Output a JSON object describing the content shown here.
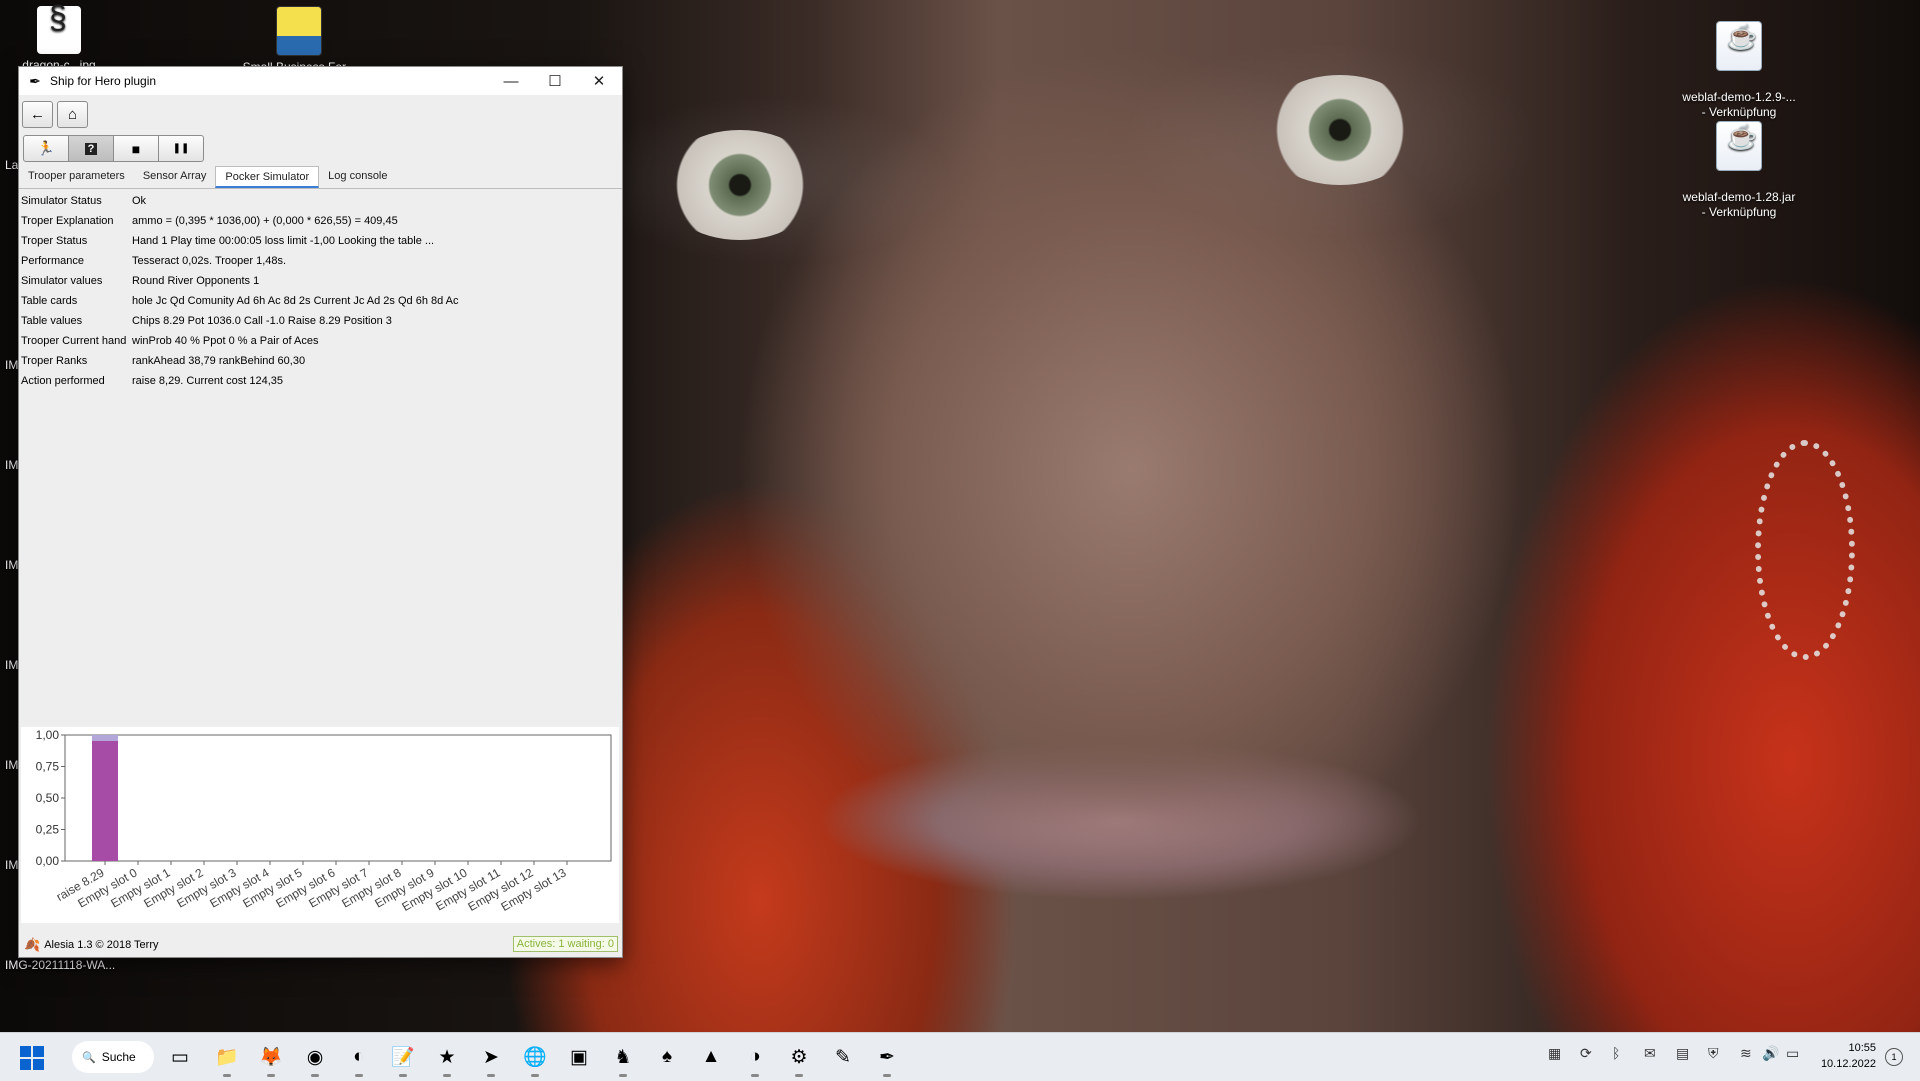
{
  "desktop": {
    "icons": [
      {
        "label": "dragon-c...jpg"
      },
      {
        "label": "Small Business For..."
      },
      {
        "label": "weblaf-demo-1.2.9-...\n- Verknüpfung"
      },
      {
        "label": "weblaf-demo-1.28.jar\n- Verknüpfung"
      }
    ],
    "side_labels": [
      "La",
      "IM",
      "IM",
      "IM",
      "IM",
      "IM",
      "IM"
    ],
    "bottom_label": "IMG-20211118-WA..."
  },
  "window": {
    "title": "Ship for Hero plugin",
    "buttons": {
      "minimize": "—",
      "maximize": "☐",
      "close": "✕"
    },
    "nav": {
      "back_icon": "←",
      "home_icon": "⌂"
    },
    "toolbar": {
      "run_icon": "🏃",
      "help_icon": "?",
      "stop_icon": "■",
      "pause_icon": "❚❚"
    },
    "tabs": [
      "Trooper parameters",
      "Sensor Array",
      "Pocker Simulator",
      "Log console"
    ],
    "active_tab": "Pocker Simulator",
    "properties": [
      {
        "key": "Simulator Status",
        "value": "Ok"
      },
      {
        "key": "Troper Explanation",
        "value": "ammo = (0,395 * 1036,00) + (0,000 * 626,55) = 409,45"
      },
      {
        "key": "Troper Status",
        "value": "Hand 1 Play time 00:00:05 loss limit -1,00 Looking the table ..."
      },
      {
        "key": "Performance",
        "value": "Tesseract 0,02s. Trooper 1,48s."
      },
      {
        "key": "Simulator values",
        "value": "Round River Opponents 1"
      },
      {
        "key": "Table cards",
        "value": "hole Jc Qd Comunity Ad 6h Ac 8d 2s Current Jc Ad 2s Qd 6h 8d Ac"
      },
      {
        "key": "Table values",
        "value": "Chips 8.29 Pot 1036.0 Call -1.0 Raise 8.29 Position 3"
      },
      {
        "key": "Trooper Current hand",
        "value": "winProb 40 % Ppot 0 % a Pair of Aces"
      },
      {
        "key": "Troper Ranks",
        "value": "rankAhead 38,79 rankBehind 60,30"
      },
      {
        "key": "Action performed",
        "value": "raise 8,29. Current cost 124,35"
      }
    ],
    "status": {
      "text": "Alesia 1.3 © 2018 Terry",
      "badge": "Actives: 1 waiting: 0",
      "leaf_icon": "🍂"
    }
  },
  "chart_data": {
    "type": "bar",
    "categories": [
      "raise 8.29",
      "Empty slot 0",
      "Empty slot 1",
      "Empty slot 2",
      "Empty slot 3",
      "Empty slot 4",
      "Empty slot 5",
      "Empty slot 6",
      "Empty slot 7",
      "Empty slot 8",
      "Empty slot 9",
      "Empty slot 10",
      "Empty slot 11",
      "Empty slot 12",
      "Empty slot 13"
    ],
    "values": [
      1.0,
      0,
      0,
      0,
      0,
      0,
      0,
      0,
      0,
      0,
      0,
      0,
      0,
      0,
      0
    ],
    "yticks": [
      "0,00",
      "0,25",
      "0,50",
      "0,75",
      "1,00"
    ],
    "ylim": [
      0,
      1
    ],
    "bar_color": "#a64ca6",
    "bar_top_color": "#b3a6d9"
  },
  "taskbar": {
    "search_label": "Suche",
    "search_icon": "🔍",
    "apps": [
      "files",
      "explorer",
      "firefox",
      "chrome",
      "eclipse",
      "notepad",
      "pokerstars",
      "arrow",
      "globe",
      "office",
      "app",
      "spade",
      "vlc",
      "eclipse2",
      "settings",
      "pen",
      "hero"
    ],
    "clock_time": "10:55",
    "clock_date": "10.12.2022",
    "notifications": "1"
  }
}
